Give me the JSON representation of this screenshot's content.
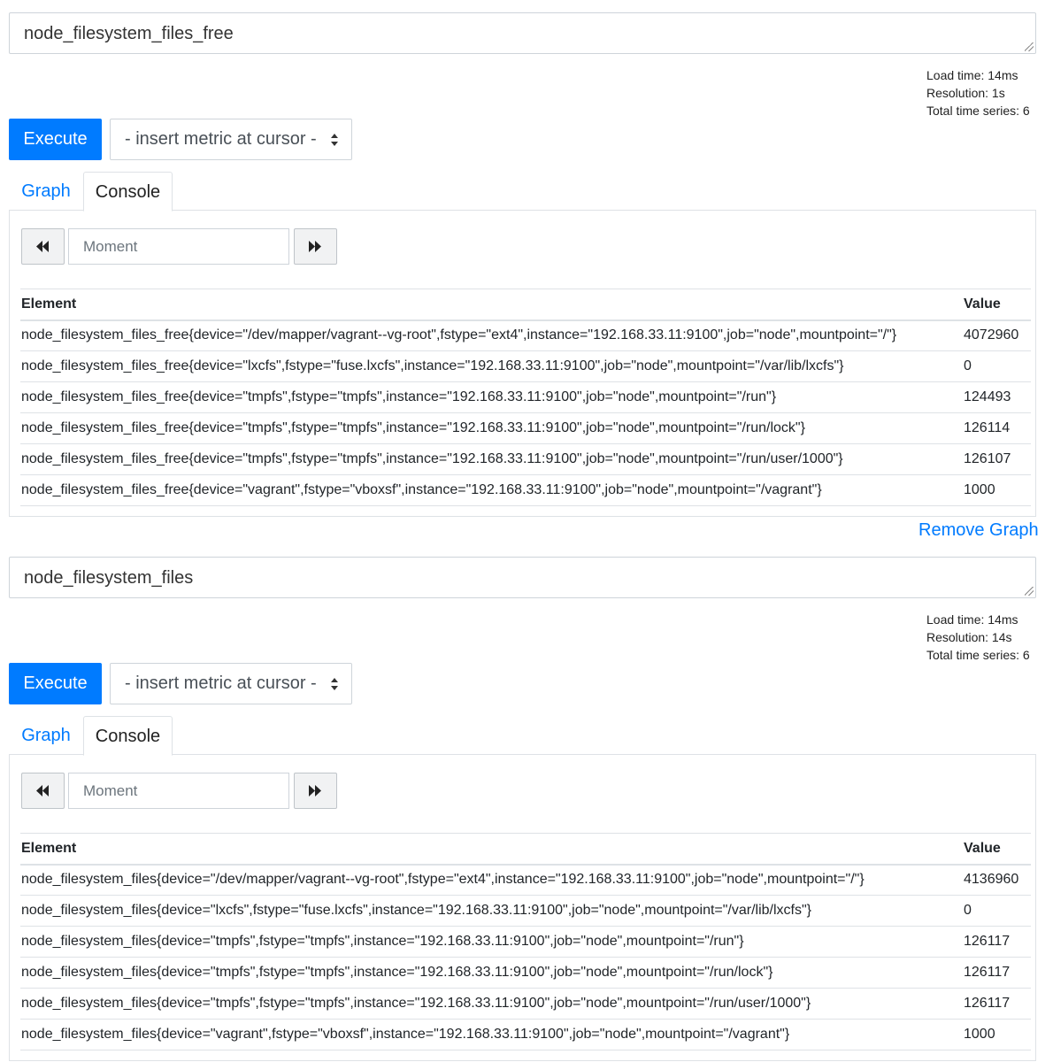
{
  "common": {
    "execute_label": "Execute",
    "insert_metric_label": "- insert metric at cursor -",
    "tab_graph": "Graph",
    "tab_console": "Console",
    "moment_placeholder": "Moment",
    "col_element": "Element",
    "col_value": "Value",
    "remove_graph": "Remove Graph",
    "accent_color": "#007bff"
  },
  "panels": [
    {
      "expression": "node_filesystem_files_free",
      "load_time": "Load time: 14ms",
      "resolution": "Resolution: 1s",
      "total_series": "Total time series: 6",
      "rows": [
        {
          "element": "node_filesystem_files_free{device=\"/dev/mapper/vagrant--vg-root\",fstype=\"ext4\",instance=\"192.168.33.11:9100\",job=\"node\",mountpoint=\"/\"}",
          "value": "4072960"
        },
        {
          "element": "node_filesystem_files_free{device=\"lxcfs\",fstype=\"fuse.lxcfs\",instance=\"192.168.33.11:9100\",job=\"node\",mountpoint=\"/var/lib/lxcfs\"}",
          "value": "0"
        },
        {
          "element": "node_filesystem_files_free{device=\"tmpfs\",fstype=\"tmpfs\",instance=\"192.168.33.11:9100\",job=\"node\",mountpoint=\"/run\"}",
          "value": "124493"
        },
        {
          "element": "node_filesystem_files_free{device=\"tmpfs\",fstype=\"tmpfs\",instance=\"192.168.33.11:9100\",job=\"node\",mountpoint=\"/run/lock\"}",
          "value": "126114"
        },
        {
          "element": "node_filesystem_files_free{device=\"tmpfs\",fstype=\"tmpfs\",instance=\"192.168.33.11:9100\",job=\"node\",mountpoint=\"/run/user/1000\"}",
          "value": "126107"
        },
        {
          "element": "node_filesystem_files_free{device=\"vagrant\",fstype=\"vboxsf\",instance=\"192.168.33.11:9100\",job=\"node\",mountpoint=\"/vagrant\"}",
          "value": "1000"
        }
      ]
    },
    {
      "expression": "node_filesystem_files",
      "load_time": "Load time: 14ms",
      "resolution": "Resolution: 14s",
      "total_series": "Total time series: 6",
      "rows": [
        {
          "element": "node_filesystem_files{device=\"/dev/mapper/vagrant--vg-root\",fstype=\"ext4\",instance=\"192.168.33.11:9100\",job=\"node\",mountpoint=\"/\"}",
          "value": "4136960"
        },
        {
          "element": "node_filesystem_files{device=\"lxcfs\",fstype=\"fuse.lxcfs\",instance=\"192.168.33.11:9100\",job=\"node\",mountpoint=\"/var/lib/lxcfs\"}",
          "value": "0"
        },
        {
          "element": "node_filesystem_files{device=\"tmpfs\",fstype=\"tmpfs\",instance=\"192.168.33.11:9100\",job=\"node\",mountpoint=\"/run\"}",
          "value": "126117"
        },
        {
          "element": "node_filesystem_files{device=\"tmpfs\",fstype=\"tmpfs\",instance=\"192.168.33.11:9100\",job=\"node\",mountpoint=\"/run/lock\"}",
          "value": "126117"
        },
        {
          "element": "node_filesystem_files{device=\"tmpfs\",fstype=\"tmpfs\",instance=\"192.168.33.11:9100\",job=\"node\",mountpoint=\"/run/user/1000\"}",
          "value": "126117"
        },
        {
          "element": "node_filesystem_files{device=\"vagrant\",fstype=\"vboxsf\",instance=\"192.168.33.11:9100\",job=\"node\",mountpoint=\"/vagrant\"}",
          "value": "1000"
        }
      ]
    }
  ]
}
